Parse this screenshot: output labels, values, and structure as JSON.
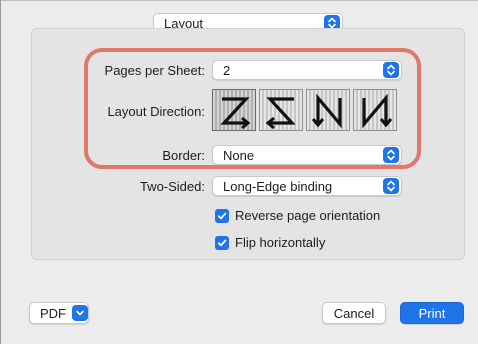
{
  "top": {
    "section_popup": "Layout"
  },
  "layout": {
    "pages_per_sheet_label": "Pages per Sheet:",
    "pages_per_sheet_value": "2",
    "layout_direction_label": "Layout Direction:",
    "border_label": "Border:",
    "border_value": "None",
    "two_sided_label": "Two-Sided:",
    "two_sided_value": "Long-Edge binding",
    "reverse_label": "Reverse page orientation",
    "flip_label": "Flip horizontally"
  },
  "footer": {
    "pdf_label": "PDF",
    "cancel_label": "Cancel",
    "print_label": "Print"
  },
  "colors": {
    "accent": "#1f74e8",
    "highlight": "#e07868"
  },
  "icons": [
    "chevron-updown-icon",
    "layout-direction-z-icon",
    "layout-direction-reverse-z-icon",
    "layout-direction-n-reverse-icon",
    "layout-direction-n-icon",
    "checkmark-icon",
    "chevron-down-icon"
  ]
}
